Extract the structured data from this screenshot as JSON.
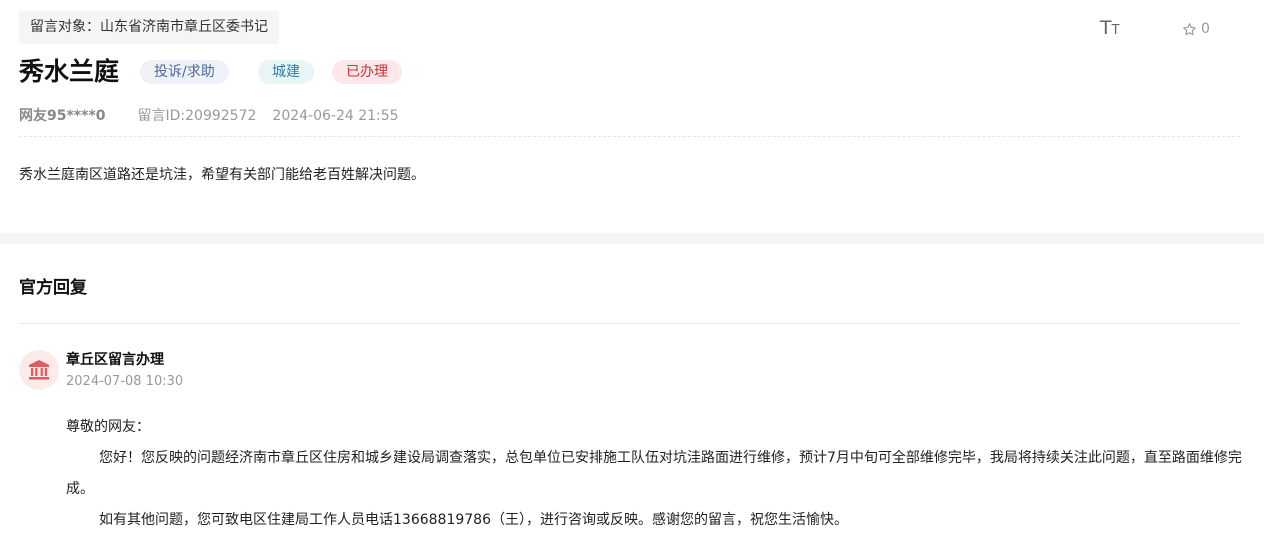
{
  "message": {
    "target": "留言对象：山东省济南市章丘区委书记",
    "title": "秀水兰庭",
    "tags": {
      "type": "投诉/求助",
      "category": "城建",
      "status": "已办理"
    },
    "user": "网友95****0",
    "message_id": "留言ID:20992572",
    "time": "2024-06-24 21:55",
    "content": "秀水兰庭南区道路还是坑洼，希望有关部门能给老百姓解决问题。"
  },
  "toolbar": {
    "font_size_icon": "font-size-icon",
    "favorite_icon": "star-icon",
    "favorite_count": "0"
  },
  "reply": {
    "section_title": "官方回复",
    "org_icon": "government-building-icon",
    "org_name": "章丘区留言办理",
    "time": "2024-07-08 10:30",
    "greeting": "尊敬的网友：",
    "paragraph1": "您好！您反映的问题经济南市章丘区住房和城乡建设局调查落实，总包单位已安排施工队伍对坑洼路面进行维修，预计7月中旬可全部维修完毕，我局将持续关注此问题，直至路面维修完成。",
    "paragraph2": "如有其他问题，您可致电区住建局工作人员电话13668819786（王），进行咨询或反映。感谢您的留言，祝您生活愉快。"
  },
  "colors": {
    "tag_type_bg": "#eef1f8",
    "tag_category_bg": "#e8f6f6",
    "tag_status_bg": "#fde9ec",
    "status_red": "#d0303d",
    "avatar_icon": "#e05a5a"
  }
}
